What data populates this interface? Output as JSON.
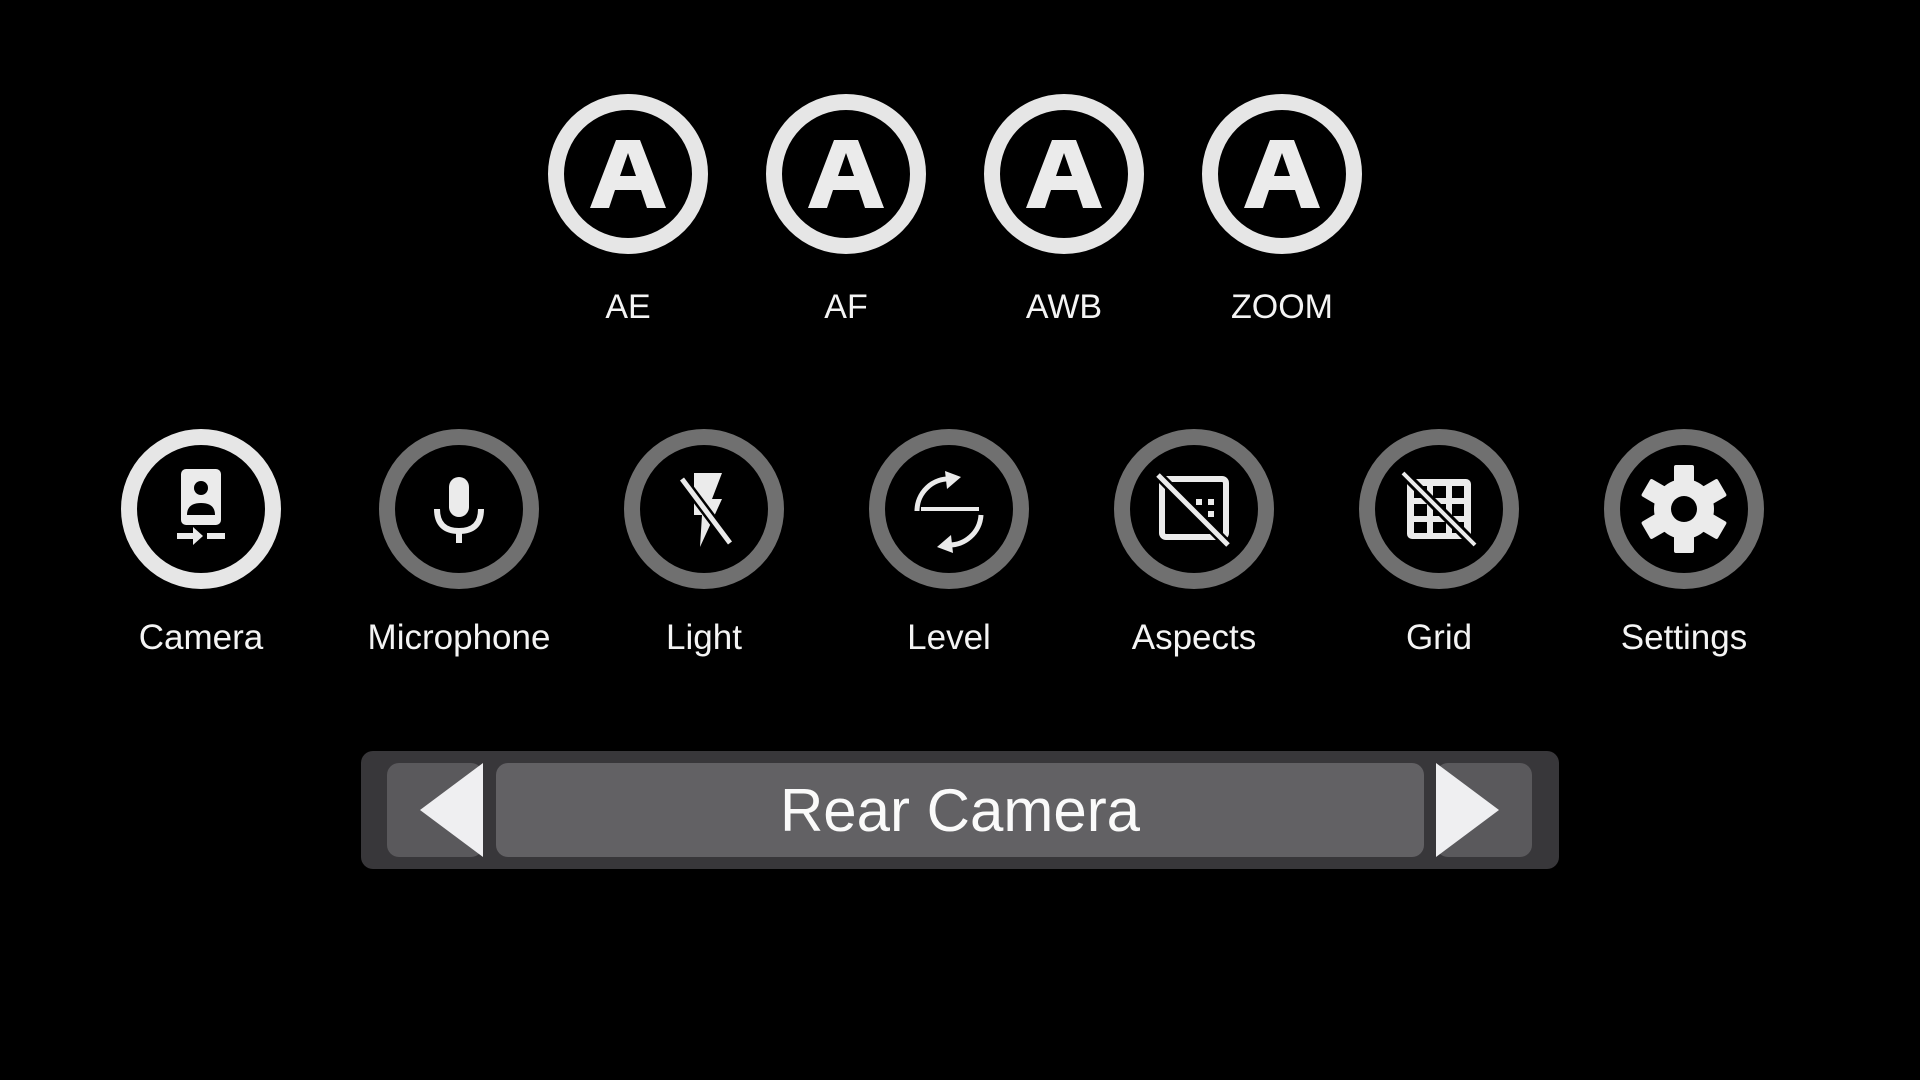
{
  "auto_controls": [
    {
      "id": "ae",
      "label": "AE",
      "icon": "auto-a-icon",
      "state": "on"
    },
    {
      "id": "af",
      "label": "AF",
      "icon": "auto-a-icon",
      "state": "on"
    },
    {
      "id": "awb",
      "label": "AWB",
      "icon": "auto-a-icon",
      "state": "on"
    },
    {
      "id": "zoom",
      "label": "ZOOM",
      "icon": "auto-a-icon",
      "state": "on"
    }
  ],
  "tools": [
    {
      "id": "camera",
      "label": "Camera",
      "icon": "camera-switch-icon",
      "state": "on"
    },
    {
      "id": "microphone",
      "label": "Microphone",
      "icon": "microphone-icon",
      "state": "off"
    },
    {
      "id": "light",
      "label": "Light",
      "icon": "flash-off-icon",
      "state": "off"
    },
    {
      "id": "level",
      "label": "Level",
      "icon": "level-rotate-icon",
      "state": "off"
    },
    {
      "id": "aspects",
      "label": "Aspects",
      "icon": "aspect-ratio-off-icon",
      "state": "off"
    },
    {
      "id": "grid",
      "label": "Grid",
      "icon": "grid-off-icon",
      "state": "off"
    },
    {
      "id": "settings",
      "label": "Settings",
      "icon": "gear-icon",
      "state": "off"
    }
  ],
  "camera_selector": {
    "value": "Rear Camera",
    "prev_icon": "triangle-left-icon",
    "next_icon": "triangle-right-icon"
  },
  "colors": {
    "background": "#000000",
    "active_ring": "#e6e6e6",
    "inactive_ring": "#707070",
    "icon_fill": "#ebebeb",
    "bar_outer": "#38373a",
    "bar_field": "#626164"
  }
}
